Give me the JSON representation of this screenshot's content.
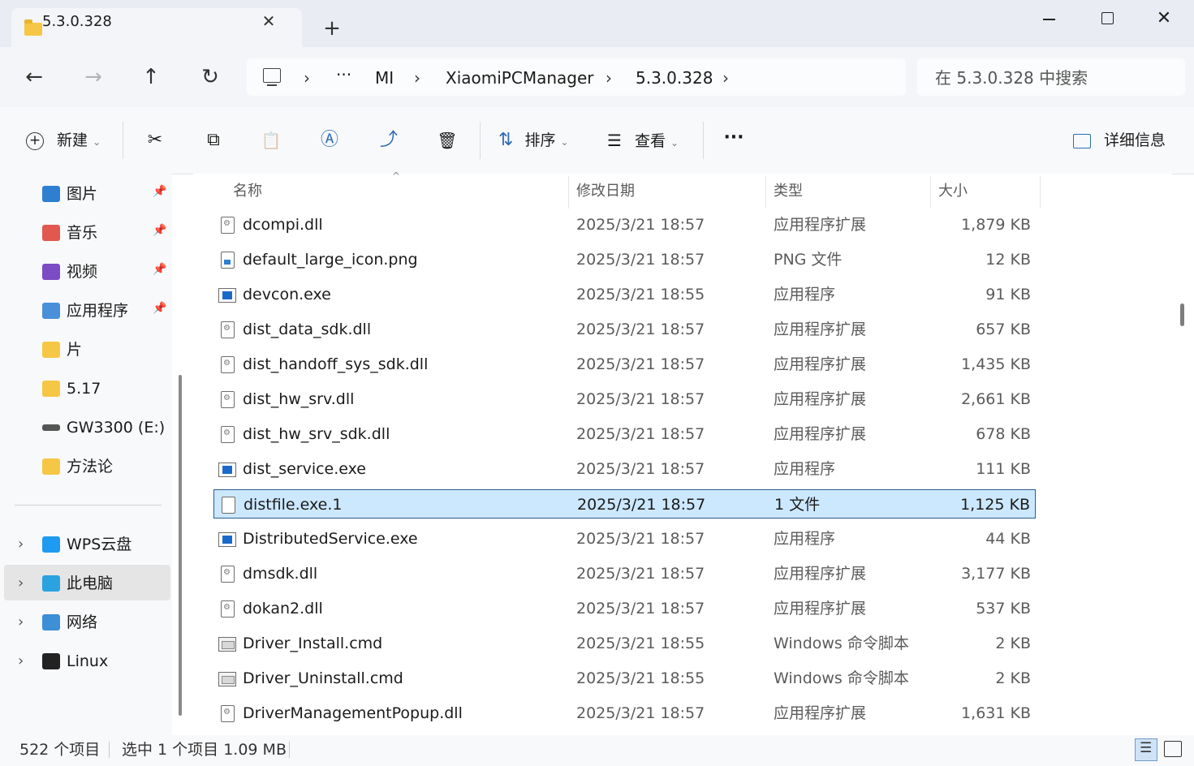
{
  "window": {
    "tab_title": "5.3.0.328",
    "close_tab_glyph": "✕",
    "new_tab_glyph": "+",
    "close_glyph": "✕"
  },
  "nav": {
    "back_glyph": "←",
    "forward_glyph": "→",
    "up_glyph": "↑",
    "refresh_glyph": "↻"
  },
  "breadcrumb": {
    "more": "···",
    "items": [
      "MI",
      "XiaomiPCManager",
      "5.3.0.328"
    ],
    "separator": "›"
  },
  "search": {
    "placeholder": "在 5.3.0.328 中搜索"
  },
  "toolbar": {
    "new_label": "新建",
    "sort_label": "排序",
    "view_label": "查看",
    "more_glyph": "···",
    "details_label": "详细信息",
    "cut_glyph": "✂",
    "copy_glyph": "⧉",
    "paste_glyph": "📋",
    "rename_glyph": "Ⓐ",
    "share_glyph": "⤴",
    "delete_glyph": "🗑",
    "sort_glyph": "⇅",
    "view_glyph": "☰",
    "chevron_glyph": "⌄"
  },
  "sidebar": {
    "pin_glyph": "📌",
    "expand_glyph": "›",
    "quick_access": [
      {
        "label": "图片",
        "icon": "pictures-icon",
        "color": "#2f7fd1",
        "pinned": true
      },
      {
        "label": "音乐",
        "icon": "music-icon",
        "color": "#e0584e",
        "pinned": true
      },
      {
        "label": "视频",
        "icon": "videos-icon",
        "color": "#7b4cc4",
        "pinned": true
      },
      {
        "label": "应用程序",
        "icon": "app-folder-icon",
        "color": "#4a90d9",
        "pinned": true
      },
      {
        "label": "片",
        "icon": "folder-icon",
        "color": "#f6c744",
        "pinned": false
      },
      {
        "label": "5.17",
        "icon": "folder-icon",
        "color": "#f6c744",
        "pinned": false
      },
      {
        "label": "GW3300 (E:)",
        "icon": "drive-icon",
        "color": "#555555",
        "pinned": false
      },
      {
        "label": "方法论",
        "icon": "folder-icon",
        "color": "#f6c744",
        "pinned": false
      }
    ],
    "locations": [
      {
        "label": "WPS云盘",
        "icon": "cloud-icon",
        "color": "#1e9bf0"
      },
      {
        "label": "此电脑",
        "icon": "computer-icon",
        "color": "#2aa3e0"
      },
      {
        "label": "网络",
        "icon": "network-icon",
        "color": "#3d8fd6"
      },
      {
        "label": "Linux",
        "icon": "linux-icon",
        "color": "#222222"
      }
    ]
  },
  "columns": {
    "name": "名称",
    "modified": "修改日期",
    "type": "类型",
    "size": "大小"
  },
  "files": [
    {
      "name": "dcompi.dll",
      "date": "2025/3/21 18:57",
      "type": "应用程序扩展",
      "size": "1,879 KB",
      "kind": "dll"
    },
    {
      "name": "default_large_icon.png",
      "date": "2025/3/21 18:57",
      "type": "PNG 文件",
      "size": "12 KB",
      "kind": "png"
    },
    {
      "name": "devcon.exe",
      "date": "2025/3/21 18:55",
      "type": "应用程序",
      "size": "91 KB",
      "kind": "exe"
    },
    {
      "name": "dist_data_sdk.dll",
      "date": "2025/3/21 18:57",
      "type": "应用程序扩展",
      "size": "657 KB",
      "kind": "dll"
    },
    {
      "name": "dist_handoff_sys_sdk.dll",
      "date": "2025/3/21 18:57",
      "type": "应用程序扩展",
      "size": "1,435 KB",
      "kind": "dll"
    },
    {
      "name": "dist_hw_srv.dll",
      "date": "2025/3/21 18:57",
      "type": "应用程序扩展",
      "size": "2,661 KB",
      "kind": "dll"
    },
    {
      "name": "dist_hw_srv_sdk.dll",
      "date": "2025/3/21 18:57",
      "type": "应用程序扩展",
      "size": "678 KB",
      "kind": "dll"
    },
    {
      "name": "dist_service.exe",
      "date": "2025/3/21 18:57",
      "type": "应用程序",
      "size": "111 KB",
      "kind": "exe"
    },
    {
      "name": "distfile.exe.1",
      "date": "2025/3/21 18:57",
      "type": "1 文件",
      "size": "1,125 KB",
      "kind": "blank",
      "selected": true
    },
    {
      "name": "DistributedService.exe",
      "date": "2025/3/21 18:57",
      "type": "应用程序",
      "size": "44 KB",
      "kind": "exe"
    },
    {
      "name": "dmsdk.dll",
      "date": "2025/3/21 18:57",
      "type": "应用程序扩展",
      "size": "3,177 KB",
      "kind": "dll"
    },
    {
      "name": "dokan2.dll",
      "date": "2025/3/21 18:57",
      "type": "应用程序扩展",
      "size": "537 KB",
      "kind": "dll"
    },
    {
      "name": "Driver_Install.cmd",
      "date": "2025/3/21 18:55",
      "type": "Windows 命令脚本",
      "size": "2 KB",
      "kind": "cmd"
    },
    {
      "name": "Driver_Uninstall.cmd",
      "date": "2025/3/21 18:55",
      "type": "Windows 命令脚本",
      "size": "2 KB",
      "kind": "cmd"
    },
    {
      "name": "DriverManagementPopup.dll",
      "date": "2025/3/21 18:57",
      "type": "应用程序扩展",
      "size": "1,631 KB",
      "kind": "dll"
    }
  ],
  "status": {
    "count": "522 个项目",
    "selection": "选中 1 个项目  1.09 MB"
  }
}
